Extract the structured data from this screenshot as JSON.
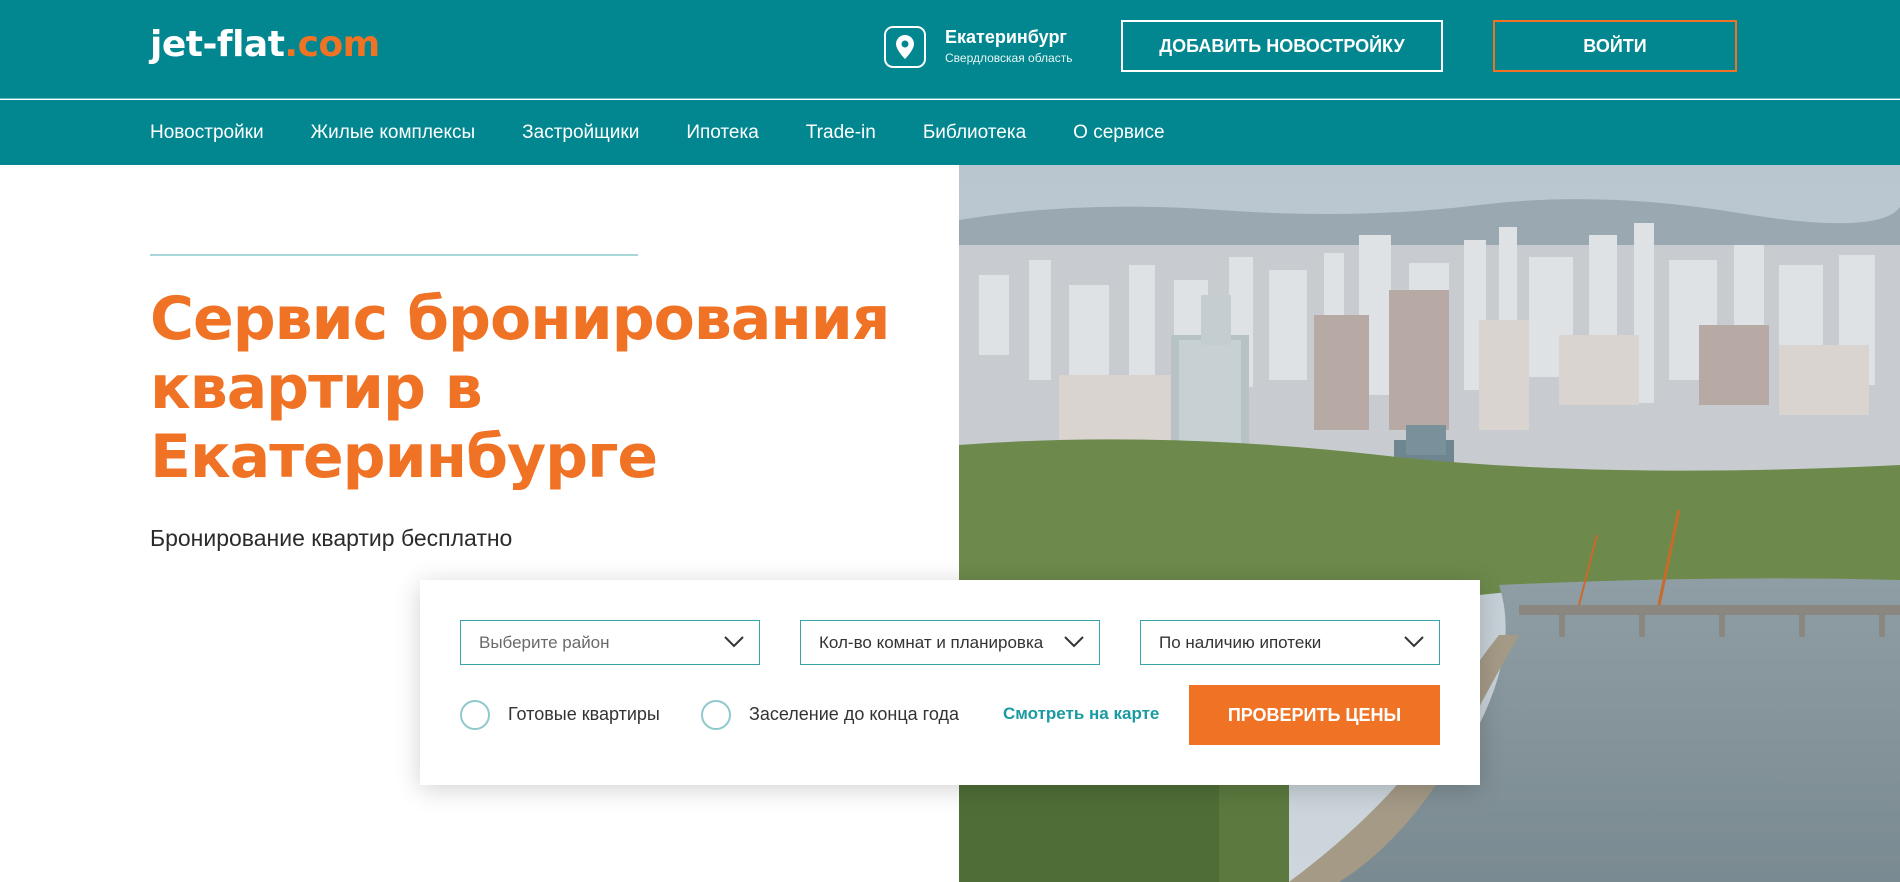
{
  "header": {
    "logo_main": "jet-flat",
    "logo_tld": ".com",
    "city": "Екатеринбург",
    "region": "Свердловская область",
    "add_button": "ДОБАВИТЬ НОВОСТРОЙКУ",
    "login_button": "ВОЙТИ"
  },
  "nav": {
    "items": [
      {
        "label": "Новостройки"
      },
      {
        "label": "Жилые комплексы"
      },
      {
        "label": "Застройщики"
      },
      {
        "label": "Ипотека"
      },
      {
        "label": "Trade-in"
      },
      {
        "label": "Библиотека"
      },
      {
        "label": "О сервисе"
      }
    ]
  },
  "hero": {
    "title_line1": "Сервис бронирования",
    "title_line2": "квартир в",
    "title_line3": "Екатеринбурге",
    "subtitle": "Бронирование квартир бесплатно"
  },
  "search": {
    "district_select": "Выберите район",
    "rooms_select": "Кол-во комнат и планировка",
    "mortgage_select": "По наличию ипотеки",
    "ready_checkbox": "Готовые квартиры",
    "move_in_checkbox": "Заселение до конца года",
    "map_link": "Смотреть на карте",
    "submit_button": "ПРОВЕРИТЬ ЦЕНЫ"
  },
  "colors": {
    "brand_teal": "#028790",
    "accent_orange": "#f07325"
  },
  "icons": {
    "location": "map-pin-icon",
    "dropdown": "chevron-down-icon",
    "photo": "city-skyline-photo"
  }
}
